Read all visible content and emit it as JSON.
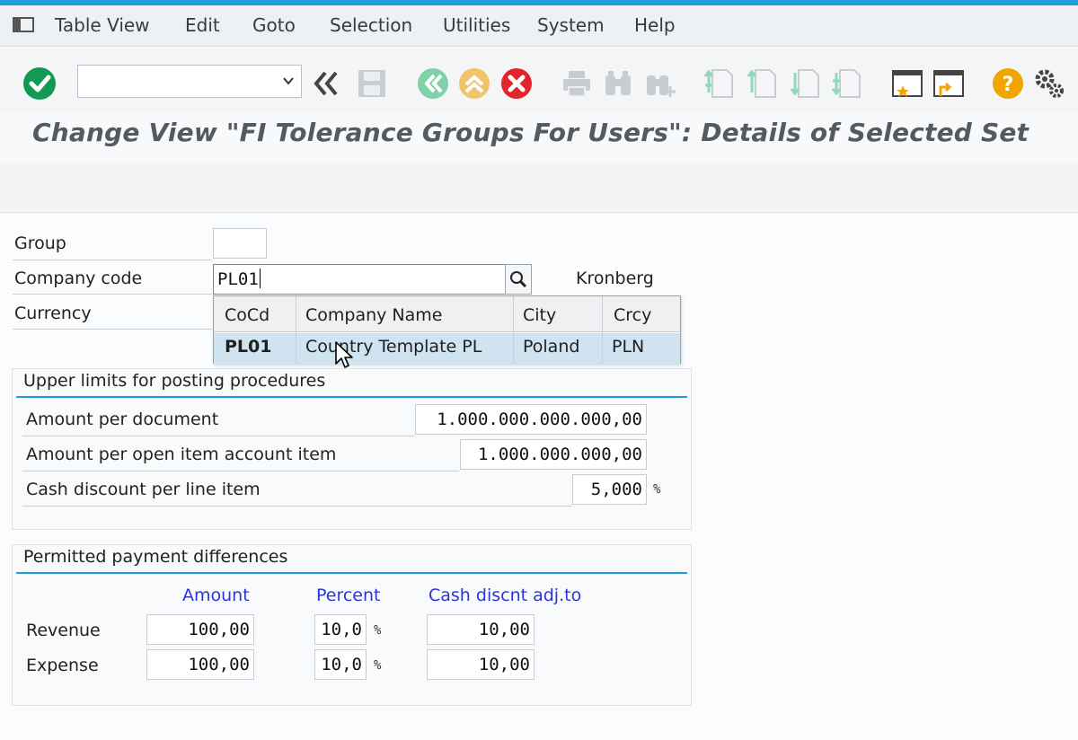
{
  "menubar": {
    "items": [
      {
        "label": "Table View"
      },
      {
        "label": "Edit"
      },
      {
        "label": "Goto"
      },
      {
        "label": "Selection"
      },
      {
        "label": "Utilities"
      },
      {
        "label": "System"
      },
      {
        "label": "Help"
      }
    ]
  },
  "toolbar": {
    "command_value": "",
    "icons": [
      "enter-check-icon",
      "command-dropdown-icon",
      "collapse-icon",
      "save-icon",
      "back-icon",
      "exit-icon",
      "cancel-icon",
      "print-icon",
      "find-icon",
      "find-next-icon",
      "first-page-icon",
      "previous-page-icon",
      "next-page-icon",
      "last-page-icon",
      "new-session-icon",
      "shortcut-icon",
      "help-icon",
      "settings-icon"
    ],
    "colors": {
      "enter": "#129a55",
      "nav_green": "#7fd2a8",
      "nav_yellow": "#f2c46a",
      "cancel": "#e2252b",
      "help": "#f0a500"
    }
  },
  "title": "Change View \"FI Tolerance Groups For Users\": Details of Selected Set",
  "form": {
    "group_label": "Group",
    "group_value": "",
    "company_code_label": "Company code",
    "company_code_value": "PL01",
    "company_city": "Kronberg",
    "currency_label": "Currency"
  },
  "popup": {
    "headers": [
      "CoCd",
      "Company Name",
      "City",
      "Crcy"
    ],
    "row": {
      "cocd": "PL01",
      "name": "Country Template PL",
      "city": "Poland",
      "crcy": "PLN"
    }
  },
  "upper_limits": {
    "title": "Upper limits for posting procedures",
    "rows": [
      {
        "label": "Amount per document",
        "value": "1.000.000.000.000,00"
      },
      {
        "label": "Amount per open item account item",
        "value": "1.000.000.000,00"
      },
      {
        "label": "Cash discount per line item",
        "value": "5,000",
        "unit": "%"
      }
    ]
  },
  "payment_diff": {
    "title": "Permitted payment differences",
    "col_amount": "Amount",
    "col_percent": "Percent",
    "col_cash": "Cash discnt adj.to",
    "rows": [
      {
        "label": "Revenue",
        "amount": "100,00",
        "percent": "10,0",
        "unit": "%",
        "cash": "10,00"
      },
      {
        "label": "Expense",
        "amount": "100,00",
        "percent": "10,0",
        "unit": "%",
        "cash": "10,00"
      }
    ]
  }
}
